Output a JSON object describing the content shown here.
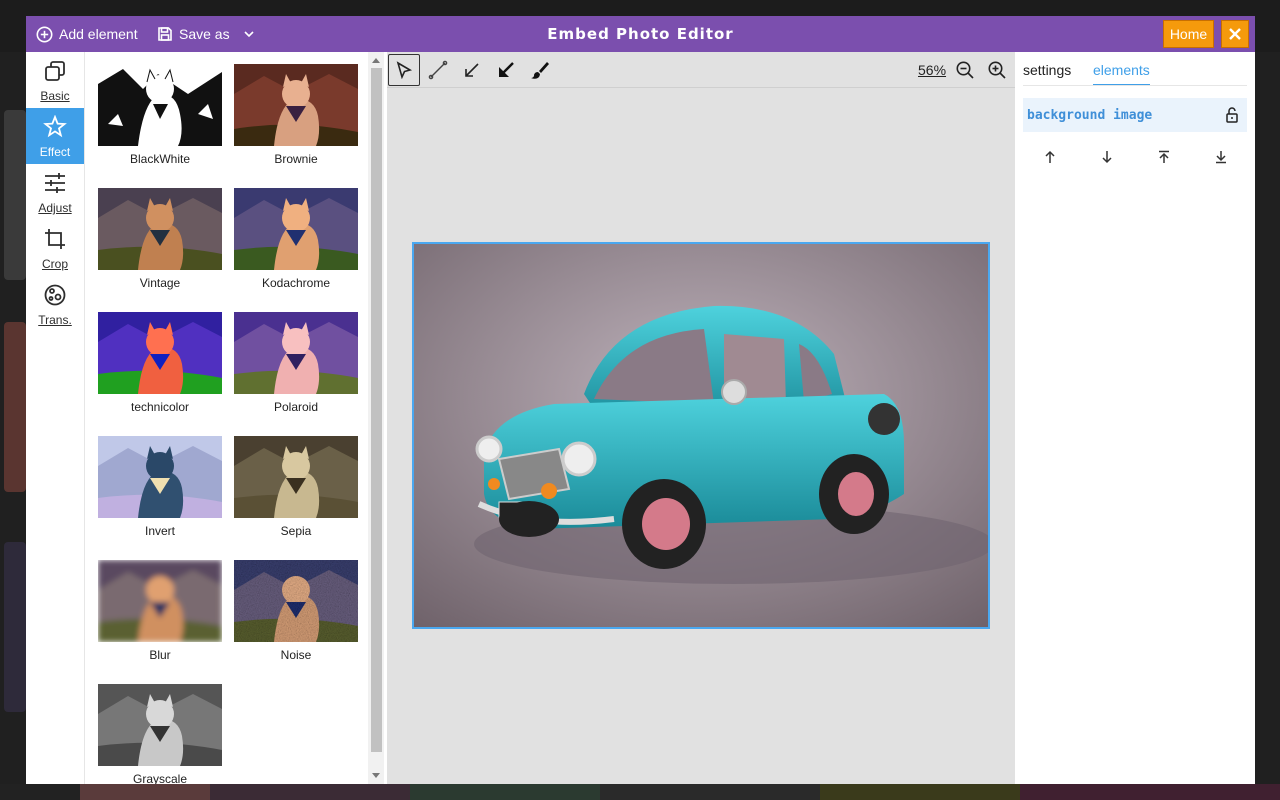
{
  "app": {
    "title": "Embed Photo Editor",
    "add_element_label": "Add element",
    "save_as_label": "Save as",
    "home_label": "Home"
  },
  "leftnav": [
    {
      "label": "Basic",
      "icon": "layers-icon"
    },
    {
      "label": "Effect",
      "icon": "magic-icon",
      "active": true
    },
    {
      "label": "Adjust",
      "icon": "sliders-icon"
    },
    {
      "label": "Crop",
      "icon": "crop-icon"
    },
    {
      "label": "Trans.",
      "icon": "transform-icon"
    }
  ],
  "effects": [
    {
      "label": "BlackWhite"
    },
    {
      "label": "Brownie"
    },
    {
      "label": "Vintage"
    },
    {
      "label": "Kodachrome"
    },
    {
      "label": "technicolor"
    },
    {
      "label": "Polaroid"
    },
    {
      "label": "Invert"
    },
    {
      "label": "Sepia"
    },
    {
      "label": "Blur"
    },
    {
      "label": "Noise"
    },
    {
      "label": "Grayscale"
    }
  ],
  "toolbar": {
    "zoom": "56%",
    "tools": [
      "select-tool",
      "line-tool",
      "arrow-tool",
      "filled-arrow-tool",
      "brush-tool"
    ]
  },
  "rightpanel": {
    "tabs": [
      "settings",
      "elements"
    ],
    "active_tab": "elements",
    "layer_name": "background image"
  },
  "colors": {
    "header": "#7b4fae",
    "accent": "#3f9fe8",
    "home": "#f59a0c"
  }
}
